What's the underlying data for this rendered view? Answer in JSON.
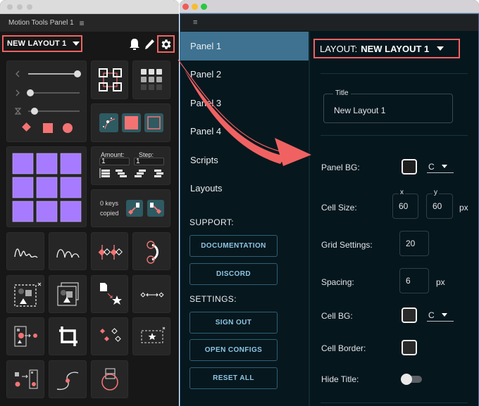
{
  "left_window": {
    "panel_title": "Motion Tools Panel 1",
    "menu_icon": "hamburger-icon",
    "layout_dropdown": {
      "value": "NEW LAYOUT 1",
      "icon": "caret-down-icon"
    },
    "toolbar_icons": [
      "bell-icon",
      "pencil-icon",
      "gear-icon"
    ],
    "amount_label": "Amount:",
    "amount_value": "1",
    "step_label": "Step:",
    "step_value": "1",
    "keys_copied_line1": "0 keys",
    "keys_copied_line2": "copied",
    "tools": [
      "easing-sliders",
      "anchor-grid-icon",
      "anchor-point-grid-icon",
      "shape-buttons",
      "purple-grid-icon",
      "sequence-layers",
      "copy-keys",
      "wiggle-icon",
      "bounce-icon",
      "keyframe-nudge-icon",
      "loop-icon",
      "precompose-remove-icon",
      "precompose-icon",
      "file-to-shape-icon",
      "distribute-icon",
      "extract-to-comp-icon",
      "crop-icon",
      "keyframe-select-icon",
      "star-remove-icon",
      "parent-to-comp-icon",
      "path-follow-icon",
      "null-circle-icon"
    ],
    "colors": {
      "accent": "#f06262",
      "purple": "#a67bff",
      "teal": "#2e5a62"
    }
  },
  "right_window": {
    "header_icon": "hamburger-icon",
    "nav": [
      {
        "label": "Panel 1",
        "active": true
      },
      {
        "label": "Panel 2",
        "active": false
      },
      {
        "label": "Panel 3",
        "active": false
      },
      {
        "label": "Panel 4",
        "active": false
      },
      {
        "label": "Scripts",
        "active": false
      },
      {
        "label": "Layouts",
        "active": false
      }
    ],
    "support_label": "SUPPORT:",
    "support_buttons": [
      "DOCUMENTATION",
      "DISCORD"
    ],
    "settings_label": "SETTINGS:",
    "settings_buttons": [
      "SIGN OUT",
      "OPEN CONFIGS",
      "RESET ALL"
    ],
    "layout_header": {
      "prefix": "LAYOUT:",
      "value": "NEW LAYOUT 1"
    },
    "title_field": {
      "legend": "Title",
      "value": "New Layout 1"
    },
    "panel_bg": {
      "label": "Panel BG:",
      "select": "C",
      "swatch": "#1e1e1e"
    },
    "cell_size": {
      "label": "Cell Size:",
      "x_legend": "x",
      "x": "60",
      "y_legend": "y",
      "y": "60",
      "unit": "px"
    },
    "grid_settings": {
      "label": "Grid Settings:",
      "value": "20"
    },
    "spacing": {
      "label": "Spacing:",
      "value": "6",
      "unit": "px"
    },
    "cell_bg": {
      "label": "Cell BG:",
      "select": "C",
      "swatch": "#2a2a2a"
    },
    "cell_border": {
      "label": "Cell Border:",
      "swatch": "#2a2a2a"
    },
    "hide_title": {
      "label": "Hide Title:",
      "on": false
    },
    "colors": {
      "active_nav": "#3e7290",
      "button_text": "#8ec6e4",
      "frame": "#2f6fb2"
    }
  }
}
